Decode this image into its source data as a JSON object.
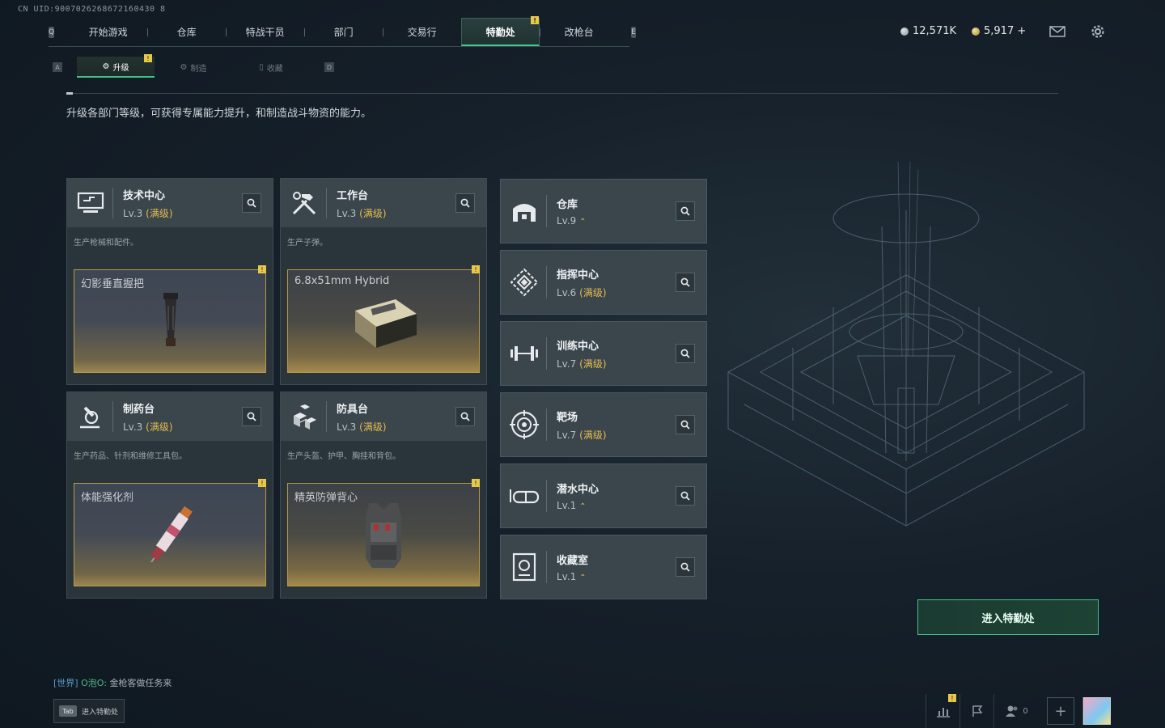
{
  "uid": "CN UID:9007026268672160430 8",
  "nav": {
    "left_key": "Q",
    "right_key": "E",
    "items": [
      "开始游戏",
      "仓库",
      "特战干员",
      "部门",
      "交易行",
      "特勤处",
      "改枪台"
    ],
    "active": "特勤处",
    "active_badge": "!"
  },
  "currency": {
    "silver": "12,571K",
    "gold": "5,917 +"
  },
  "subnav": {
    "left_key": "A",
    "right_key": "D",
    "tabs": [
      "升级",
      "制造",
      "收藏"
    ],
    "active": "升级",
    "badge": "!"
  },
  "description": "升级各部门等级，可获得专属能力提升，和制造战斗物资的能力。",
  "departments": [
    {
      "title": "技术中心",
      "level": "Lv.3",
      "max": "(满级)",
      "desc": "生产枪械和配件。",
      "product": "幻影垂直握把",
      "icon": "tech-center-icon"
    },
    {
      "title": "工作台",
      "level": "Lv.3",
      "max": "(满级)",
      "desc": "生产子弹。",
      "product": "6.8x51mm Hybrid",
      "icon": "workbench-icon"
    },
    {
      "title": "制药台",
      "level": "Lv.3",
      "max": "(满级)",
      "desc": "生产药品、针剂和维修工具包。",
      "product": "体能强化剂",
      "icon": "pharmacy-icon"
    },
    {
      "title": "防具台",
      "level": "Lv.3",
      "max": "(满级)",
      "desc": "生产头盔、护甲、胸挂和背包。",
      "product": "精英防弹背心",
      "icon": "armor-bench-icon"
    }
  ],
  "facilities": [
    {
      "title": "仓库",
      "level": "Lv.9",
      "max": "",
      "upgrade": "⌃",
      "icon": "warehouse-icon"
    },
    {
      "title": "指挥中心",
      "level": "Lv.6",
      "max": "(满级)",
      "upgrade": "",
      "icon": "command-center-icon"
    },
    {
      "title": "训练中心",
      "level": "Lv.7",
      "max": "(满级)",
      "upgrade": "",
      "icon": "training-center-icon"
    },
    {
      "title": "靶场",
      "level": "Lv.7",
      "max": "(满级)",
      "upgrade": "",
      "icon": "shooting-range-icon"
    },
    {
      "title": "潜水中心",
      "level": "Lv.1",
      "max": "",
      "upgrade": "⌃",
      "icon": "diving-center-icon"
    },
    {
      "title": "收藏室",
      "level": "Lv.1",
      "max": "",
      "upgrade": "⌃",
      "icon": "collection-room-icon"
    }
  ],
  "enter_button": "进入特勤处",
  "chat": {
    "channel": "[世界]",
    "user": "O泡O:",
    "message": "金枪客做任务来"
  },
  "tab_hint": {
    "key": "Tab",
    "label": "进入特勤处"
  },
  "bottom": {
    "friends_count": "0"
  },
  "colors": {
    "accent_green": "#43c38a",
    "max_gold": "#e2bd4f",
    "badge_yellow": "#e7c84a"
  }
}
